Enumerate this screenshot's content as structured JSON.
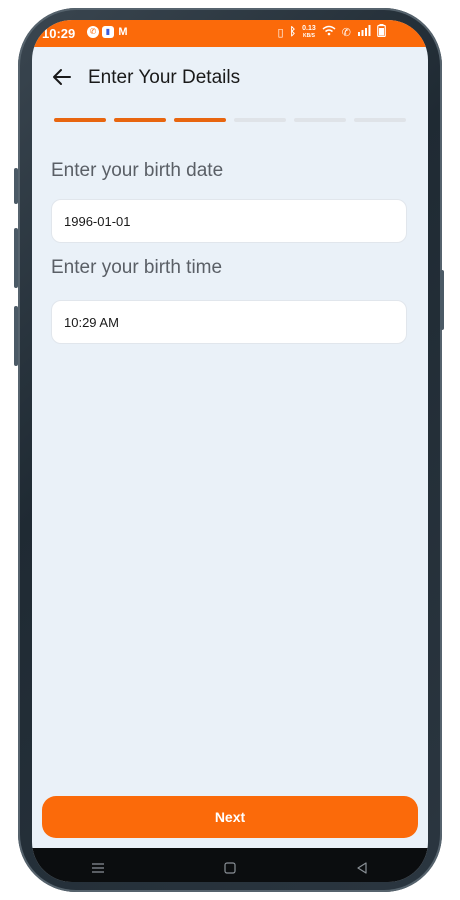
{
  "status_bar": {
    "time": "10:29",
    "net_speed_value": "0.13",
    "net_speed_unit": "KB/S",
    "icons": [
      "whatsapp-icon",
      "message-icon",
      "gmail-icon",
      "vibrate-icon",
      "bluetooth-icon",
      "wifi-icon",
      "call-icon",
      "signal-icon",
      "battery-icon"
    ]
  },
  "header": {
    "title": "Enter Your Details",
    "back_icon": "arrow-left-icon"
  },
  "progress": {
    "total_steps": 6,
    "completed_steps": 3
  },
  "form": {
    "birth_date_label": "Enter your birth date",
    "birth_date_value": "1996-01-01",
    "birth_time_label": "Enter your birth time",
    "birth_time_value": "10:29 AM"
  },
  "footer": {
    "next_label": "Next"
  },
  "nav": {
    "menu_icon": "menu-icon",
    "home_icon": "home-icon",
    "back_icon": "back-triangle-icon"
  },
  "colors": {
    "accent": "#fb6a0a",
    "background": "#eaf1f8",
    "step_inactive": "#dfe3e8"
  }
}
